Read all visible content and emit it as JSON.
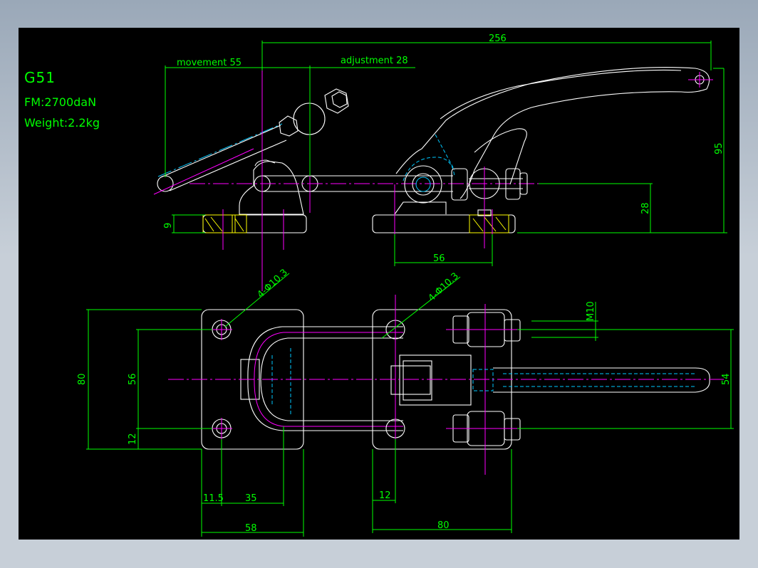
{
  "drawing": {
    "title": "G51",
    "force": "FM:2700daN",
    "weight": "Weight:2.2kg"
  },
  "dimensions": {
    "length_total": "256",
    "movement": "movement 55",
    "adjustment": "adjustment 28",
    "height_95": "95",
    "height_28": "28",
    "base_thickness": "9",
    "hole_spacing_56": "56",
    "hole_spec_left": "4-Φ10.3",
    "hole_spec_right": "4-Φ10.3",
    "thread": "M10",
    "width_80_left": "80",
    "width_56_left": "56",
    "offset_12_left": "12",
    "width_54_right": "54",
    "offset_11_5": "11.5",
    "spacing_35": "35",
    "base_58": "58",
    "offset_12_bottom": "12",
    "base_80": "80"
  },
  "colors": {
    "background": "#000000",
    "outline": "#ffffff",
    "dimension": "#00ff00",
    "centerline": "#ff00ff",
    "hidden": "#00c8ff",
    "hatch": "#ffff00"
  }
}
